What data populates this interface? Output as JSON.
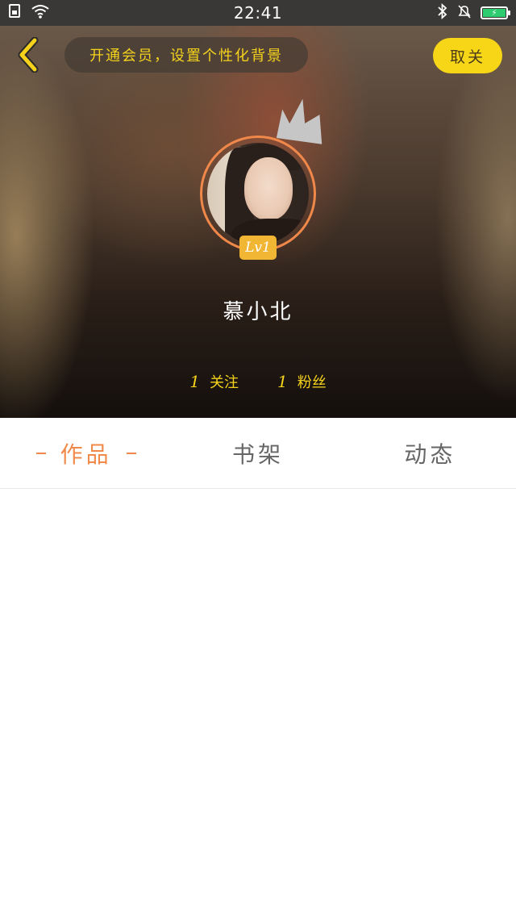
{
  "status_bar": {
    "time": "22:41",
    "icons": [
      "sim-icon",
      "wifi-icon",
      "bluetooth-icon",
      "silent-bell-icon",
      "battery-charging-icon"
    ]
  },
  "header": {
    "back_icon": "chevron-left-icon",
    "vip_banner": "开通会员，设置个性化背景",
    "follow_label": "取关"
  },
  "profile": {
    "crown_icon": "crown-icon",
    "level": "Lv1",
    "username": "慕小北",
    "following_count": "1",
    "following_label": "关注",
    "followers_count": "1",
    "followers_label": "粉丝"
  },
  "tabs": [
    {
      "label": "作品",
      "active": true
    },
    {
      "label": "书架",
      "active": false
    },
    {
      "label": "动态",
      "active": false
    }
  ],
  "colors": {
    "accent_yellow": "#f7d617",
    "accent_orange": "#f0894a",
    "level_badge": "#f1b634"
  }
}
